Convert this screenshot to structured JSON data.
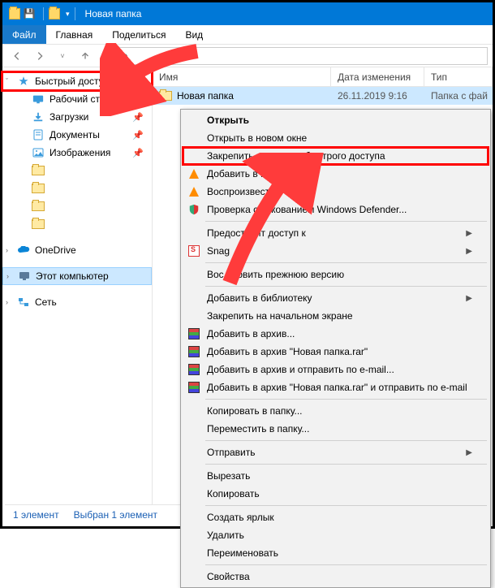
{
  "titlebar": {
    "title": "Новая папка"
  },
  "tabs": {
    "file": "Файл",
    "home": "Главная",
    "share": "Поделиться",
    "view": "Вид"
  },
  "sidebar": {
    "quick": "Быстрый доступ",
    "desktop": "Рабочий стол",
    "downloads": "Загрузки",
    "documents": "Документы",
    "pictures": "Изображения",
    "onedrive": "OneDrive",
    "thispc": "Этот компьютер",
    "network": "Сеть"
  },
  "cols": {
    "name": "Имя",
    "date": "Дата изменения",
    "type": "Тип"
  },
  "row": {
    "name": "Новая папка",
    "date": "26.11.2019 9:16",
    "type": "Папка с фай"
  },
  "ctx": {
    "open": "Открыть",
    "open_new": "Открыть в новом окне",
    "pin_quick": "Закрепить на панели быстрого доступа",
    "vlc_add": "Добавить в плейли        LC",
    "vlc_play": "Воспроизвести в",
    "defender": "Проверка с и           жованием Windows Defender...",
    "share": "Предоставит    доступ к",
    "snagit": "Snag",
    "restore": "Вос    ановить прежнюю версию",
    "library": "Добавить в библиотеку",
    "pin_start": "Закрепить на начальном экране",
    "rar1": "Добавить в архив...",
    "rar2": "Добавить в архив \"Новая папка.rar\"",
    "rar3": "Добавить в архив и отправить по e-mail...",
    "rar4": "Добавить в архив \"Новая папка.rar\" и отправить по e-mail",
    "sendto": "Отправить",
    "copyto": "Копировать в папку...",
    "moveto": "Переместить в папку...",
    "cut": "Вырезать",
    "copy": "Копировать",
    "shortcut": "Создать ярлык",
    "delete": "Удалить",
    "rename": "Переименовать",
    "props": "Свойства"
  },
  "status": {
    "count": "1 элемент",
    "selected": "Выбран 1 элемент"
  }
}
